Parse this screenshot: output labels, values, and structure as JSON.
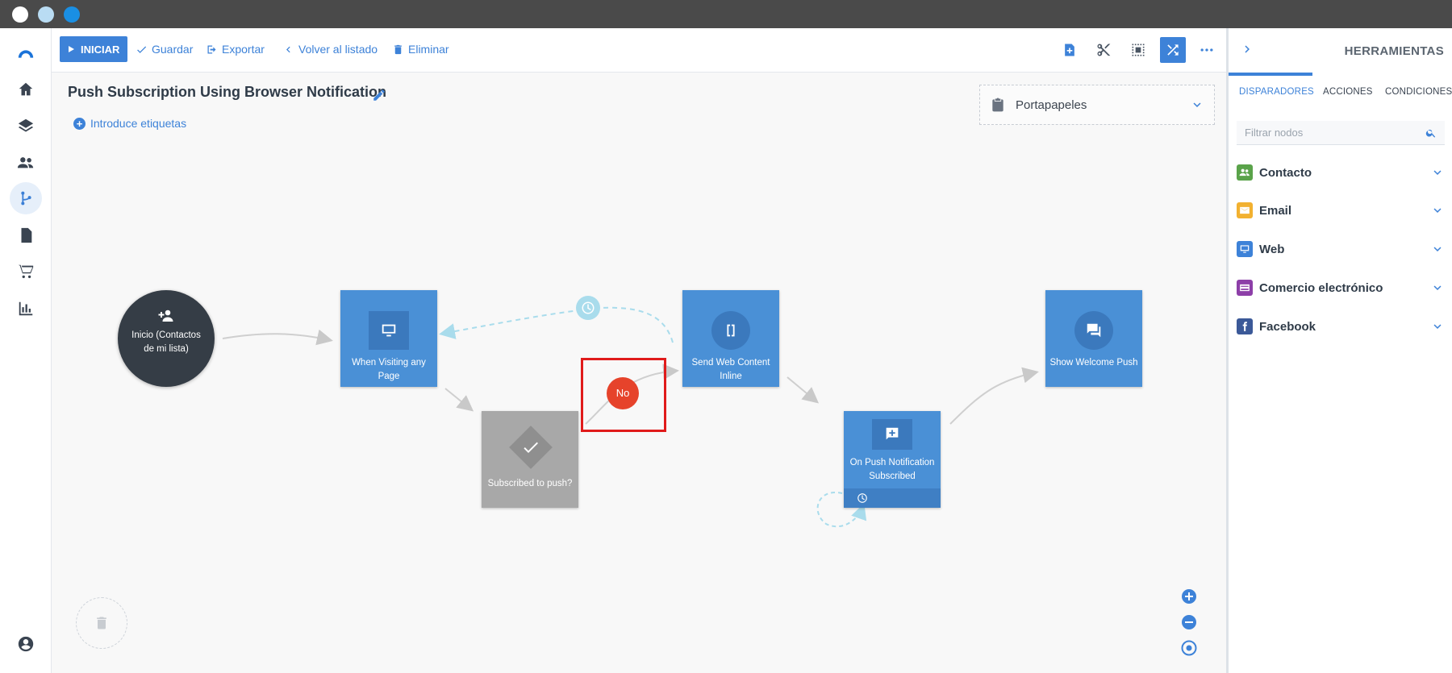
{
  "toolbar": {
    "start_label": "INICIAR",
    "save_label": "Guardar",
    "export_label": "Exportar",
    "back_label": "Volver al listado",
    "delete_label": "Eliminar"
  },
  "flow": {
    "title": "Push Subscription Using Browser Notification",
    "tags_label": "Introduce etiquetas"
  },
  "clipboard": {
    "label": "Portapapeles"
  },
  "nodes": {
    "start": "Inicio (Contactos de mi lista)",
    "visiting": "When Visiting any Page",
    "subscribed": "Subscribed to push?",
    "send_web": "Send Web Content Inline",
    "on_push": "On Push Notification Subscribed",
    "welcome": "Show Welcome Push"
  },
  "edge_labels": {
    "no": "No"
  },
  "right_panel": {
    "title": "HERRAMIENTAS",
    "tabs": [
      "DISPARADORES",
      "ACCIONES",
      "CONDICIONES"
    ],
    "search_placeholder": "Filtrar nodos",
    "categories": [
      {
        "label": "Contacto",
        "color": "#5aa34a",
        "icon": "people-icon"
      },
      {
        "label": "Email",
        "color": "#f2b130",
        "icon": "mail-icon"
      },
      {
        "label": "Web",
        "color": "#3d82d8",
        "icon": "monitor-icon"
      },
      {
        "label": "Comercio electrónico",
        "color": "#8d3fa8",
        "icon": "card-icon"
      },
      {
        "label": "Facebook",
        "color": "#3b5998",
        "icon": "facebook-icon"
      }
    ]
  },
  "colors": {
    "accent": "#3d82d8",
    "node_blue": "#4a90d6",
    "start_node": "#353d46",
    "condition_node": "#a8a8a8",
    "no_badge": "#e6432b",
    "highlight": "#e01b1b"
  }
}
